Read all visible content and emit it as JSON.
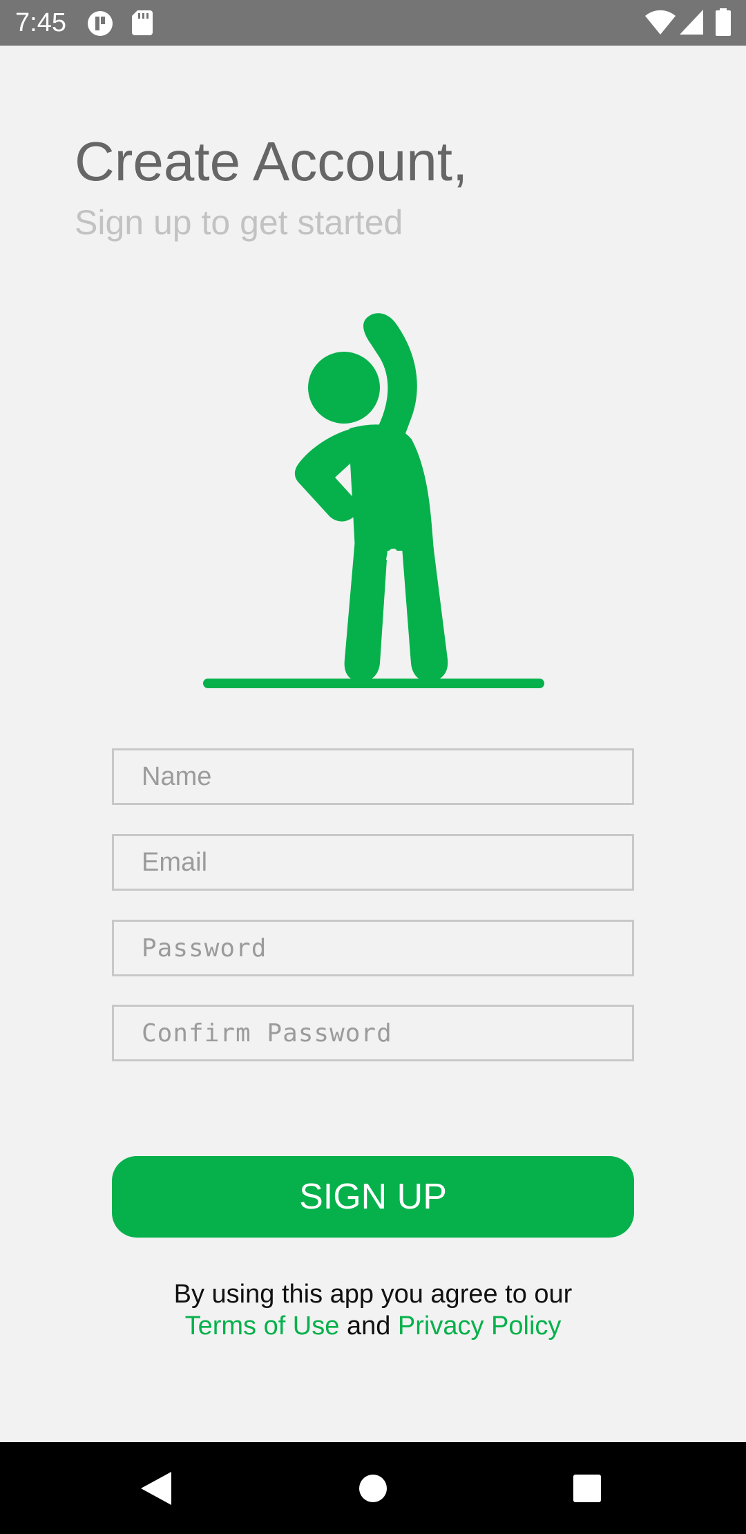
{
  "status_bar": {
    "time": "7:45",
    "icons": [
      "app-notification-icon",
      "sd-card-icon",
      "wifi-icon",
      "cellular-signal-icon",
      "battery-icon"
    ]
  },
  "header": {
    "title": "Create Account,",
    "subtitle": "Sign up to get started"
  },
  "illustration": {
    "icon": "stretching-person-icon",
    "color": "#06b14b"
  },
  "form": {
    "name_placeholder": "Name",
    "email_placeholder": "Email",
    "password_placeholder": "Password",
    "confirm_password_placeholder": "Confirm Password"
  },
  "signup": {
    "label": "SIGN UP"
  },
  "terms": {
    "prefix": "By using this app you agree to our",
    "terms_link": "Terms of Use",
    "conjunction": "and",
    "privacy_link": "Privacy Policy"
  },
  "nav_bar": {
    "icons": [
      "back-icon",
      "home-icon",
      "recents-icon"
    ]
  },
  "colors": {
    "accent": "#06b14b",
    "title": "#666666",
    "subtitle": "#c2c2c2",
    "background": "#f2f2f2"
  }
}
